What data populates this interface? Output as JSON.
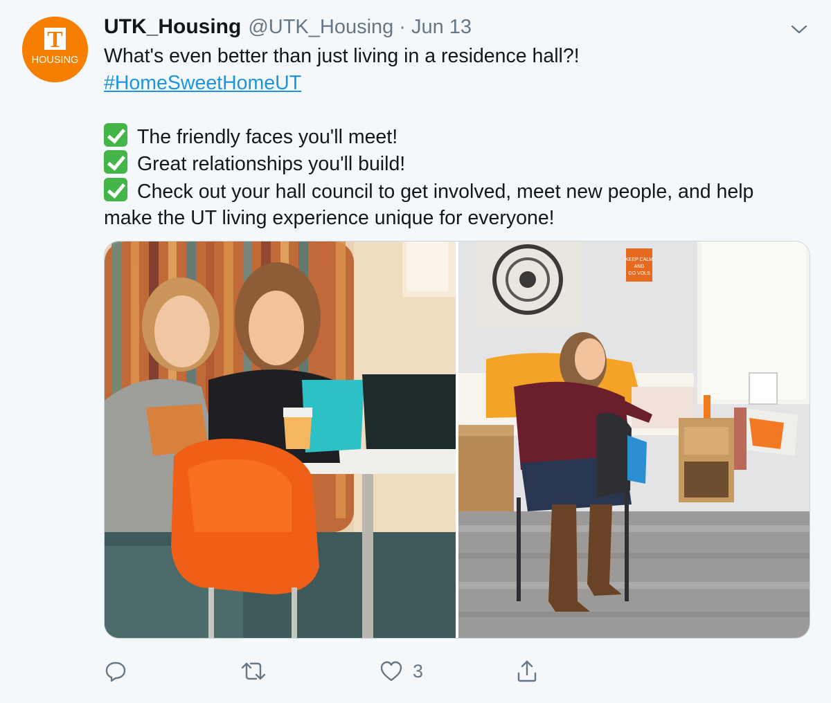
{
  "tweet": {
    "avatar_text": "HOUSING",
    "avatar_letter": "T",
    "display_name": "UTK_Housing",
    "handle": "@UTK_Housing",
    "separator": "·",
    "date": "Jun 13",
    "text_line1": "What's even better than just living in a residence hall?!",
    "hashtag": "#HomeSweetHomeUT",
    "bullets": [
      "The friendly faces you'll meet!",
      "Great relationships you'll build!",
      "Check out your hall council to get involved, meet new people, and help"
    ],
    "continuation": "make the UT living experience unique for everyone!",
    "poster_line1": "KEEP CALM",
    "poster_line2": "AND",
    "poster_line3": "GO VOLS"
  },
  "actions": {
    "like_count": "3"
  },
  "colors": {
    "accent": "#1b95e0",
    "brand_orange": "#f77f00",
    "check_green": "#44b549",
    "muted": "#657786"
  }
}
